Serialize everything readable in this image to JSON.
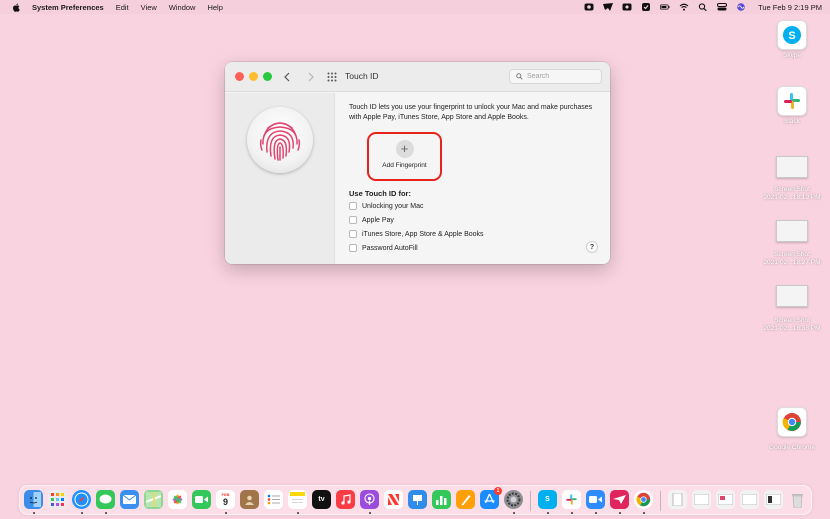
{
  "menubar": {
    "app_name": "System Preferences",
    "menus": [
      "Edit",
      "View",
      "Window",
      "Help"
    ],
    "clock": "Tue Feb 9  2:19 PM"
  },
  "window": {
    "title": "Touch ID",
    "search_placeholder": "Search",
    "description": "Touch ID lets you use your fingerprint to unlock your Mac and make purchases with Apple Pay, iTunes Store, App Store and Apple Books.",
    "add_fingerprint_label": "Add Fingerprint",
    "use_for_heading": "Use Touch ID for:",
    "options": [
      {
        "label": "Unlocking your Mac",
        "checked": false
      },
      {
        "label": "Apple Pay",
        "checked": false
      },
      {
        "label": "iTunes Store, App Store & Apple Books",
        "checked": false
      },
      {
        "label": "Password AutoFill",
        "checked": false
      }
    ],
    "help_label": "?"
  },
  "desktop": {
    "icons": [
      {
        "label": "Skype"
      },
      {
        "label": "Slack"
      },
      {
        "label_line1": "Screen Shot",
        "label_line2": "2021-02...18.19 PM"
      },
      {
        "label_line1": "Screen Shot",
        "label_line2": "2021-02...18.27 PM"
      },
      {
        "label_line1": "Screen Shot",
        "label_line2": "2021-02...18.38 PM"
      },
      {
        "label": "Google Chrome"
      }
    ]
  },
  "dock": {
    "calendar_month": "FEB",
    "calendar_day": "9",
    "appletv_label": "tv",
    "appstore_badge": "1"
  },
  "colors": {
    "desktop_bg": "#f9d3e0",
    "highlight_red": "#e8231b",
    "fingerprint_pink": "#e0456f"
  }
}
